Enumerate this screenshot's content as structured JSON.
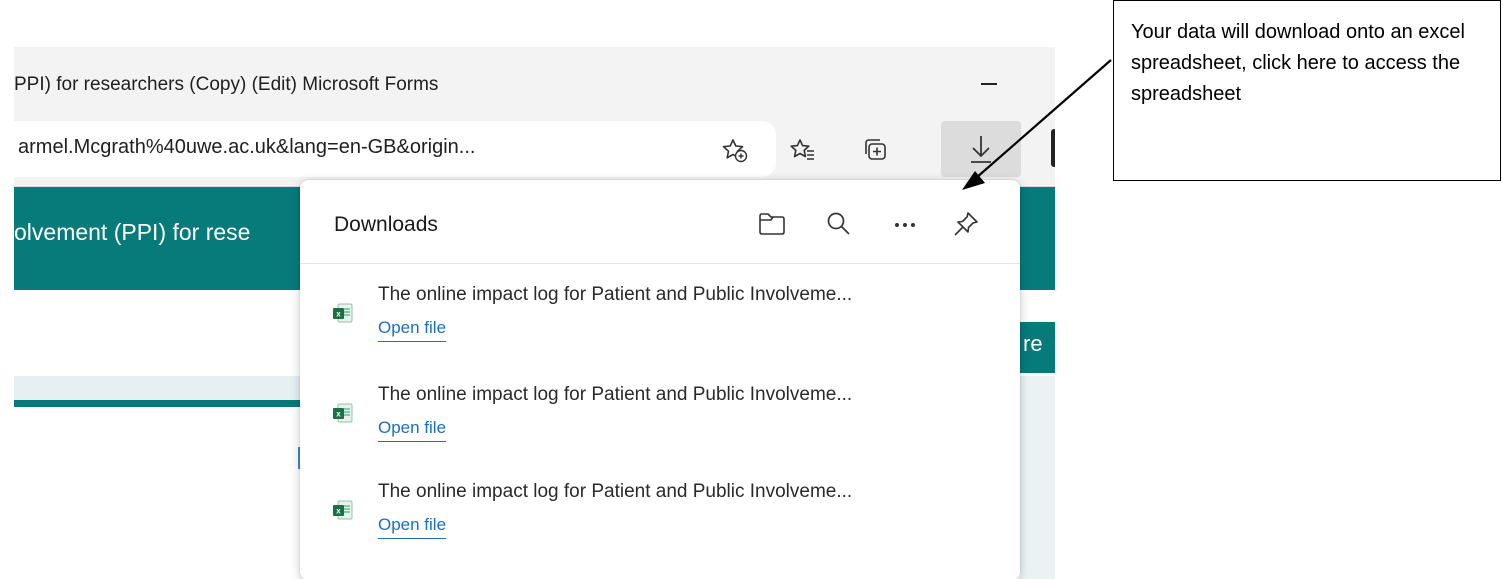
{
  "window": {
    "title": "PPI) for researchers (Copy) (Edit) Microsoft Forms",
    "address": "armel.Mcgrath%40uwe.ac.uk&lang=en-GB&origin..."
  },
  "toolbar": {
    "icons": [
      "add-favorite-icon",
      "favorites-icon",
      "collections-icon",
      "download-icon"
    ]
  },
  "page": {
    "header_title": "olvement (PPI) for rese",
    "right_text": "re"
  },
  "downloads": {
    "title": "Downloads",
    "header_icons": [
      "folder-icon",
      "search-icon",
      "more-icon",
      "pin-icon"
    ],
    "items": [
      {
        "name": "The online impact log for Patient and Public Involveme...",
        "action": "Open file"
      },
      {
        "name": "The online impact log for Patient and Public Involveme...",
        "action": "Open file"
      },
      {
        "name": "The online impact log for Patient and Public Involveme...",
        "action": "Open file"
      }
    ]
  },
  "callout": {
    "text": "Your data will download onto an excel spreadsheet, click here to access the spreadsheet"
  },
  "colors": {
    "forms_teal": "#077a7a",
    "link_blue": "#1a6fbf",
    "excel_green": "#1d7044"
  }
}
